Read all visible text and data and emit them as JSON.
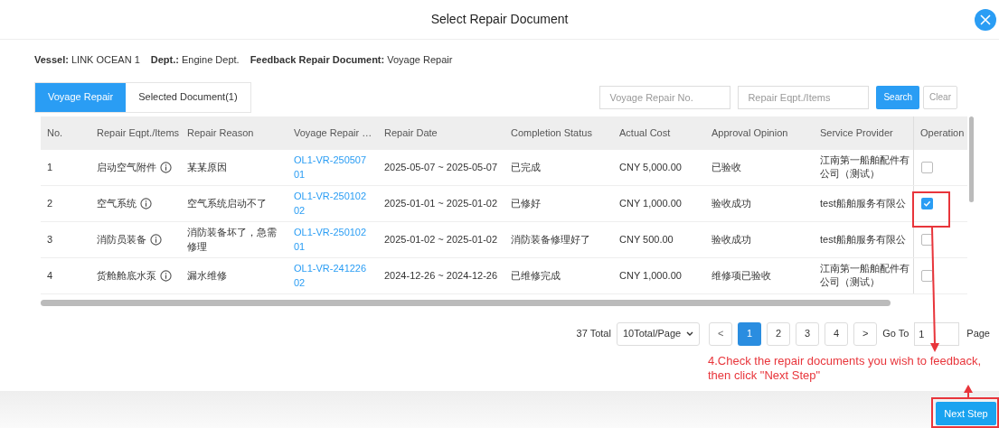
{
  "dialog": {
    "title": "Select Repair Document"
  },
  "info": [
    {
      "label": "Vessel:",
      "value": "LINK OCEAN 1"
    },
    {
      "label": "Dept.:",
      "value": "Engine Dept."
    },
    {
      "label": "Feedback Repair Document:",
      "value": "Voyage Repair"
    }
  ],
  "tabs": [
    {
      "label": "Voyage Repair",
      "selected": true
    },
    {
      "label": "Selected Document(1)",
      "selected": false
    }
  ],
  "search": {
    "fields": [
      {
        "placeholder": "Voyage Repair No."
      },
      {
        "placeholder": "Repair Eqpt./Items"
      }
    ],
    "search_button": "Search",
    "clear_button": "Clear"
  },
  "table": {
    "columns": [
      "No.",
      "Repair Eqpt./Items",
      "Repair Reason",
      "Voyage Repair …",
      "Repair Date",
      "Completion Status",
      "Actual Cost",
      "Approval Opinion",
      "Service Provider",
      "Operation"
    ],
    "rows": [
      {
        "no": "1",
        "item": "启动空气附件",
        "reason": "某某原因",
        "repair_no": "OL1-VR-25050701",
        "date": "2025-05-07  ~ 2025-05-07",
        "status": "已完成",
        "cost": "CNY 5,000.00",
        "approval": "已验收",
        "provider": [
          "江南第一船舶配件有",
          "公司（测试）"
        ],
        "checked": false
      },
      {
        "no": "2",
        "item": "空气系统",
        "reason": "空气系统启动不了",
        "repair_no": "OL1-VR-25010202",
        "date": "2025-01-01  ~ 2025-01-02",
        "status": "已修好",
        "cost": "CNY 1,000.00",
        "approval": "验收成功",
        "provider": [
          "test船舶服务有限公"
        ],
        "checked": true
      },
      {
        "no": "3",
        "item": "消防员装备",
        "reason": "消防装备坏了，急需修理",
        "repair_no": "OL1-VR-25010201",
        "date": "2025-01-02  ~ 2025-01-02",
        "status": "消防装备修理好了",
        "cost": "CNY 500.00",
        "approval": "验收成功",
        "provider": [
          "test船舶服务有限公"
        ],
        "checked": false
      },
      {
        "no": "4",
        "item": "货舱舱底水泵",
        "reason": "漏水维修",
        "repair_no": "OL1-VR-24122602",
        "date": "2024-12-26  ~ 2024-12-26",
        "status": "已维修完成",
        "cost": "CNY 1,000.00",
        "approval": "维修项已验收",
        "provider": [
          "江南第一船舶配件有",
          "公司（测试）"
        ],
        "checked": false
      }
    ]
  },
  "pagination": {
    "total": "37 Total",
    "page_size": "10Total/Page",
    "prev": "<",
    "pages": [
      {
        "label": "1",
        "selected": true
      },
      {
        "label": "2",
        "selected": false
      },
      {
        "label": "3",
        "selected": false
      },
      {
        "label": "4",
        "selected": false
      }
    ],
    "next": ">",
    "goto_label": "Go To",
    "goto_value": "1",
    "page_label": "Page"
  },
  "annotation": {
    "text": "4.Check the repair documents you wish to feedback, then click \"Next Step\""
  },
  "footer": {
    "next_button": "Next Step"
  }
}
